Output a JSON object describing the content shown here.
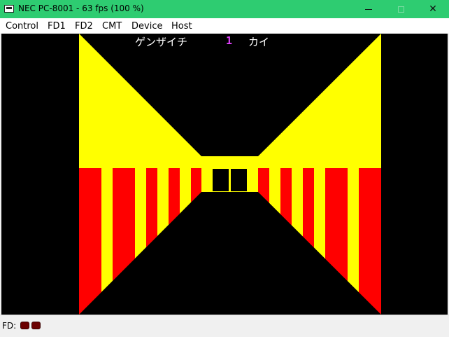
{
  "window": {
    "title": "NEC PC-8001 - 63 fps (100 %)",
    "close_glyph": "✕"
  },
  "menu": {
    "items": [
      "Control",
      "FD1",
      "FD2",
      "CMT",
      "Device",
      "Host"
    ]
  },
  "game": {
    "status_prefix": "ゲンザイチ",
    "floor_number": "1",
    "status_suffix": "カイ",
    "colors": {
      "wall_yellow": "#ffff00",
      "wall_red": "#ff0000",
      "background": "#000000"
    }
  },
  "status": {
    "label": "FD:",
    "drive_led_color": "#6b0000"
  },
  "icons": {
    "app": "pc8001-app-icon",
    "minimize": "minimize-icon",
    "maximize": "maximize-icon",
    "close": "close-icon"
  }
}
